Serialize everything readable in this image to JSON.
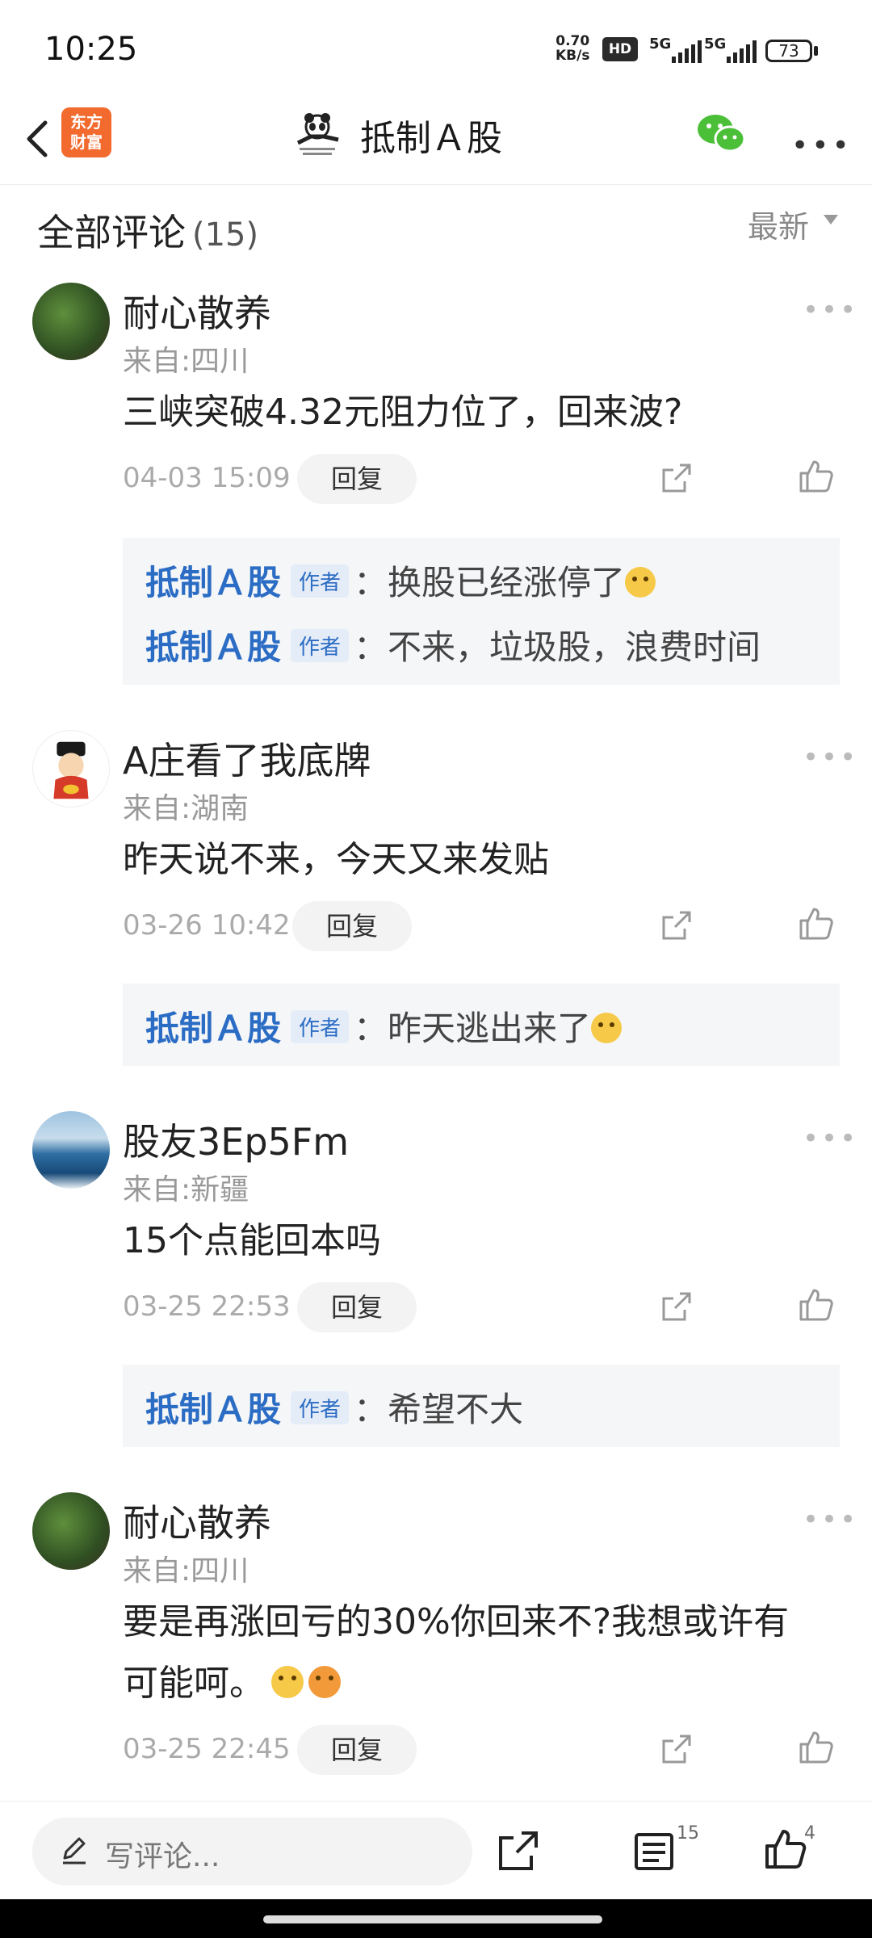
{
  "status_bar": {
    "time": "10:25",
    "net_speed_value": "0.70",
    "net_speed_unit": "KB/s",
    "hd_label": "HD",
    "net1": "5G",
    "net2": "5G",
    "battery": "73"
  },
  "nav": {
    "app_logo_line1": "东方",
    "app_logo_line2": "财富",
    "title": "抵制Ａ股"
  },
  "header": {
    "title": "全部评论",
    "count": "(15)",
    "sort_label": "最新"
  },
  "comments": [
    {
      "user": "耐心散养",
      "location": "来自:四川",
      "text": "三峡突破4.32元阻力位了，回来波?",
      "date": "04-03 15:09",
      "reply_label": "回复",
      "replies": [
        {
          "author": "抵制Ａ股",
          "tag": "作者",
          "text": "：换股已经涨停了"
        },
        {
          "author": "抵制Ａ股",
          "tag": "作者",
          "text": "：不来，垃圾股，浪费时间"
        }
      ]
    },
    {
      "user": "A庄看了我底牌",
      "location": "来自:湖南",
      "text": "昨天说不来，今天又来发贴",
      "date": "03-26 10:42",
      "reply_label": "回复",
      "replies": [
        {
          "author": "抵制Ａ股",
          "tag": "作者",
          "text": "：昨天逃出来了"
        }
      ]
    },
    {
      "user": "股友3Ep5Fm",
      "location": "来自:新疆",
      "text": "15个点能回本吗",
      "date": "03-25 22:53",
      "reply_label": "回复",
      "replies": [
        {
          "author": "抵制Ａ股",
          "tag": "作者",
          "text": "：希望不大"
        }
      ]
    },
    {
      "user": "耐心散养",
      "location": "来自:四川",
      "text_line1": "要是再涨回亏的30%你回来不?我想或许有",
      "text_line2": "可能呵。",
      "date": "03-25 22:45",
      "reply_label": "回复"
    }
  ],
  "bottom_bar": {
    "write_placeholder": "写评论...",
    "comment_count": "15",
    "like_count": "4"
  },
  "colors": {
    "accent_blue": "#2b6cc4",
    "brand_orange": "#f26a2d",
    "wechat_green": "#4cbf39"
  }
}
